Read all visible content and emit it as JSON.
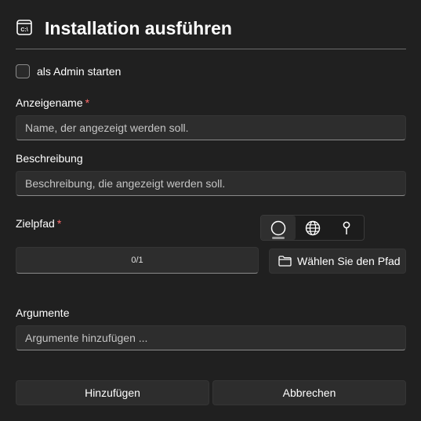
{
  "dialog": {
    "title": "Installation ausführen",
    "title_icon": "terminal-icon"
  },
  "admin_checkbox": {
    "label": "als Admin starten",
    "checked": false
  },
  "display_name": {
    "label": "Anzeigename",
    "required_mark": "*",
    "placeholder": "Name, der angezeigt werden soll.",
    "value": ""
  },
  "description": {
    "label": "Beschreibung",
    "placeholder": "Beschreibung, die angezeigt werden soll.",
    "value": ""
  },
  "target_path": {
    "label": "Zielpfad",
    "required_mark": "*",
    "source_options": [
      {
        "icon": "circle-icon",
        "selected": true
      },
      {
        "icon": "globe-icon",
        "selected": false
      },
      {
        "icon": "pin-icon",
        "selected": false
      }
    ],
    "selection_count": "0/1",
    "browse_label": "Wählen Sie den Pfad",
    "browse_icon": "folder-icon"
  },
  "arguments": {
    "label": "Argumente",
    "placeholder": "Argumente hinzufügen ...",
    "value": ""
  },
  "actions": {
    "add_label": "Hinzufügen",
    "cancel_label": "Abbrechen"
  },
  "colors": {
    "background": "#202020",
    "required": "#ff6b6b",
    "control": "#2d2d2d"
  }
}
